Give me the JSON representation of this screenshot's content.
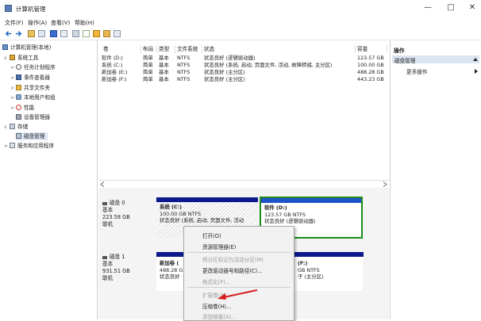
{
  "window": {
    "title": "计算机管理",
    "minimize": "—",
    "maximize": "□",
    "close": "✕"
  },
  "menu": [
    "文件(F)",
    "操作(A)",
    "查看(V)",
    "帮助(H)"
  ],
  "tree": {
    "root": "计算机管理(本地)",
    "system_tools": "系统工具",
    "task_scheduler": "任务计划程序",
    "event_viewer": "事件查看器",
    "shared_folders": "共享文件夹",
    "local_users": "本地用户和组",
    "performance": "性能",
    "device_manager": "设备管理器",
    "storage": "存储",
    "disk_management": "磁盘管理",
    "services_apps": "服务和应用程序"
  },
  "volumes": {
    "headers": [
      "卷",
      "布局",
      "类型",
      "文件系统",
      "状态",
      "容量"
    ],
    "rows": [
      {
        "name": "软件 (D:)",
        "layout": "简单",
        "type": "基本",
        "fs": "NTFS",
        "status": "状态良好 (逻辑驱动器)",
        "capacity": "123.57 GB"
      },
      {
        "name": "系统 (C:)",
        "layout": "简单",
        "type": "基本",
        "fs": "NTFS",
        "status": "状态良好 (系统, 启动, 页面文件, 活动, 故障转储, 主分区)",
        "capacity": "100.00 GB"
      },
      {
        "name": "新加卷 (E:)",
        "layout": "简单",
        "type": "基本",
        "fs": "NTFS",
        "status": "状态良好 (主分区)",
        "capacity": "488.28 GB"
      },
      {
        "name": "新加卷 (F:)",
        "layout": "简单",
        "type": "基本",
        "fs": "NTFS",
        "status": "状态良好 (主分区)",
        "capacity": "443.23 GB"
      }
    ]
  },
  "disks": {
    "disk0": {
      "name": "磁盘 0",
      "type": "基本",
      "size": "223.58 GB",
      "status": "联机"
    },
    "disk1": {
      "name": "磁盘 1",
      "type": "基本",
      "size": "931.51 GB",
      "status": "联机"
    },
    "c": {
      "name": "系统 (C:)",
      "size": "100.00 GB NTFS",
      "status": "状态良好 (系统, 启动, 页面文件, 活动"
    },
    "d": {
      "name": "软件 (D:)",
      "size": "123.57 GB NTFS",
      "status": "状态良好 (逻辑驱动器)"
    },
    "e": {
      "name": "新加卷 (",
      "size": "488.28 G",
      "status": "状态良好"
    },
    "f": {
      "name": "(F:)",
      "size": "GB NTFS",
      "status": "子 (主分区)"
    }
  },
  "actions": {
    "header": "操作",
    "section": "磁盘管理",
    "more": "更多操作"
  },
  "context_menu": {
    "open": "打开(O)",
    "explore": "资源管理器(E)",
    "mark_active": "将分区标记为活动分区(M)",
    "change_letter": "更改驱动器号和路径(C)...",
    "format": "格式化(F)...",
    "extend": "扩展卷(X)...",
    "shrink": "压缩卷(H)...",
    "add_mirror": "添加镜像(A)..."
  },
  "colors": {
    "primary_partition": "#0a1a8c",
    "logical_drive": "#1f52c9",
    "selection": "#1a8c1a",
    "annotation_arrow": "#d42020"
  }
}
